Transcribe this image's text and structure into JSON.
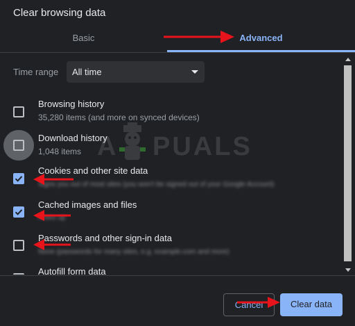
{
  "dialog": {
    "title": "Clear browsing data",
    "tabs": [
      {
        "label": "Basic",
        "active": false
      },
      {
        "label": "Advanced",
        "active": true
      }
    ],
    "time_range": {
      "label": "Time range",
      "value": "All time"
    },
    "items": [
      {
        "title": "Browsing history",
        "subtitle": "35,280 items (and more on synced devices)",
        "checked": false
      },
      {
        "title": "Download history",
        "subtitle": "1,048 items",
        "checked": false
      },
      {
        "title": "Cookies and other site data",
        "subtitle": "Signs you out of most sites (you won't be signed out of your Google Account)",
        "checked": true
      },
      {
        "title": "Cached images and files",
        "subtitle": "Frees up",
        "checked": true
      },
      {
        "title": "Passwords and other sign-in data",
        "subtitle": "None (passwords for many sites, e.g. example.com and more)",
        "checked": false
      },
      {
        "title": "Autofill form data",
        "subtitle": "",
        "checked": false
      }
    ],
    "buttons": {
      "cancel": "Cancel",
      "clear": "Clear data"
    }
  },
  "watermark": {
    "left": "A",
    "right": "PUALS"
  },
  "colors": {
    "background": "#202124",
    "accent": "#8ab4f8",
    "arrow": "#e8141c"
  }
}
